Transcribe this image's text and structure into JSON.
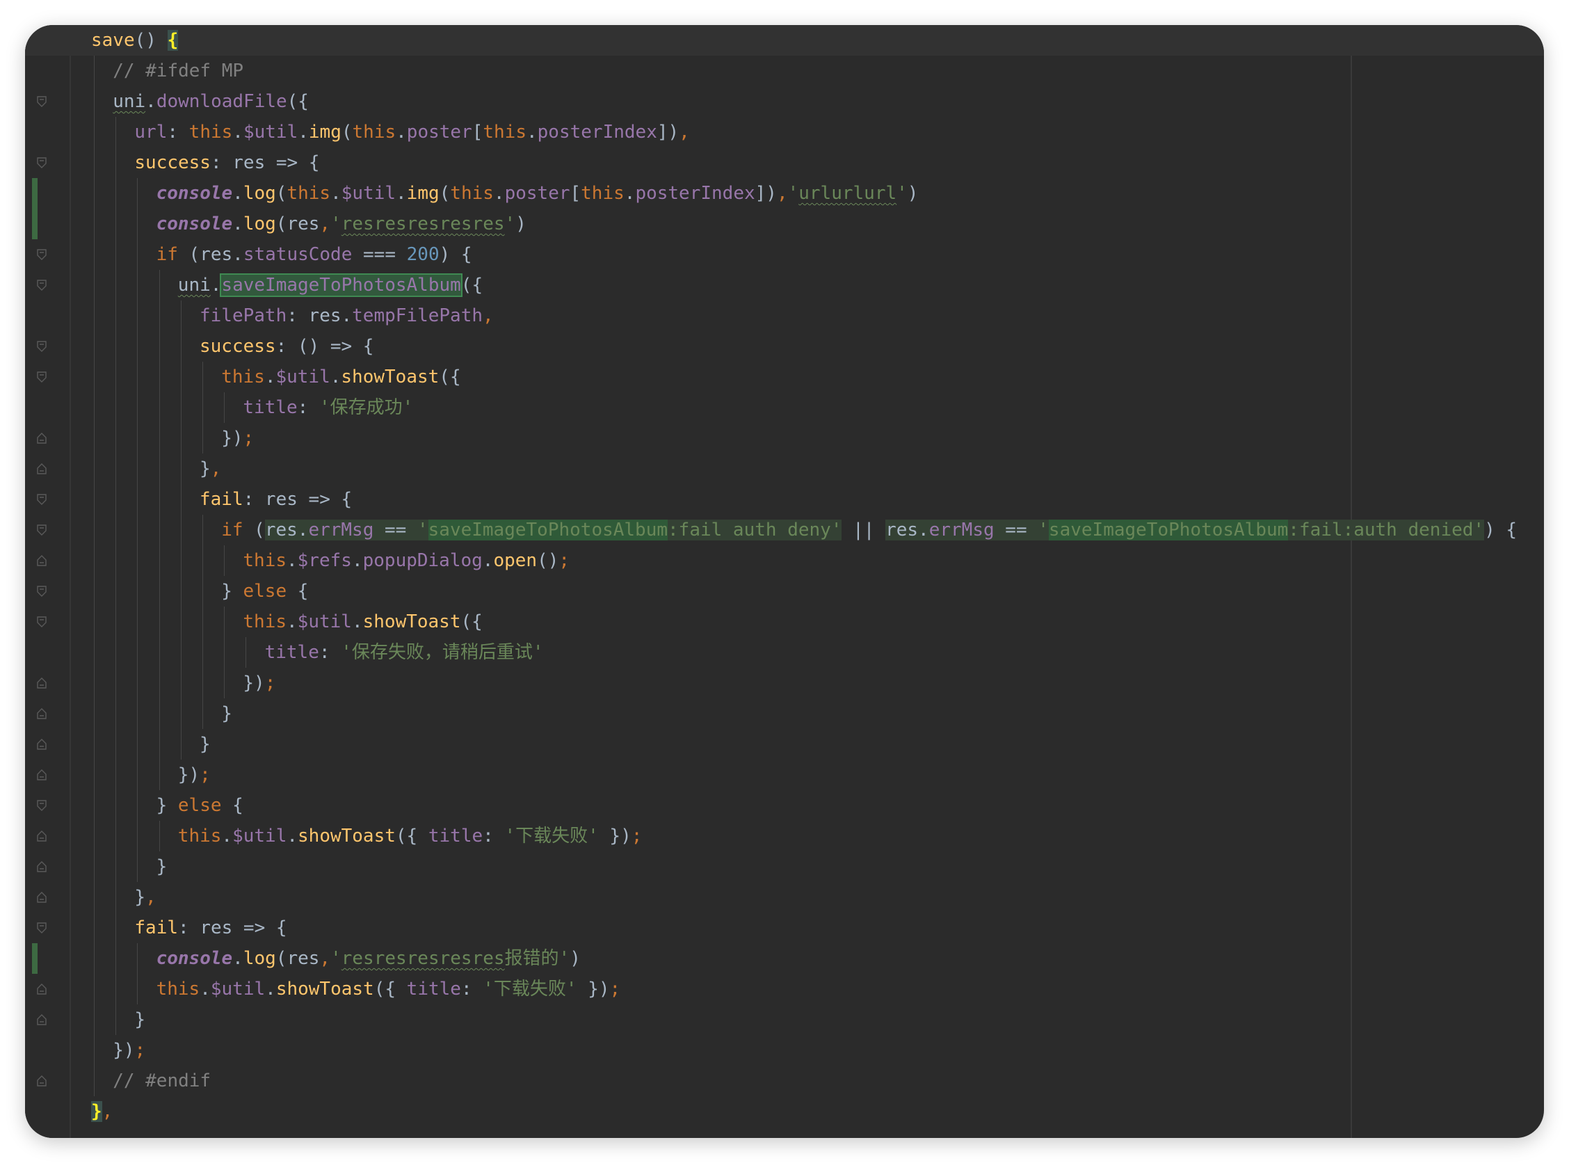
{
  "editor": {
    "language": "javascript",
    "colors": {
      "background": "#2b2b2b",
      "keyword": "#cc7832",
      "function": "#ffc66d",
      "property": "#9876aa",
      "string": "#6a8759",
      "number": "#6897bb",
      "comment": "#808080",
      "text": "#a9b7c6"
    },
    "lines": [
      {
        "indent": 1,
        "tokens": [
          {
            "t": "save",
            "c": "f"
          },
          {
            "t": "() "
          },
          {
            "t": "{",
            "c": "brace-y"
          }
        ]
      },
      {
        "indent": 2,
        "tokens": [
          {
            "t": "// #ifdef MP",
            "c": "c"
          }
        ]
      },
      {
        "indent": 2,
        "tokens": [
          {
            "t": "uni",
            "c": "sq"
          },
          {
            "t": "."
          },
          {
            "t": "downloadFile",
            "c": "p"
          },
          {
            "t": "({"
          }
        ]
      },
      {
        "indent": 3,
        "tokens": [
          {
            "t": "url",
            "c": "p"
          },
          {
            "t": ": "
          },
          {
            "t": "this",
            "c": "k"
          },
          {
            "t": "."
          },
          {
            "t": "$util",
            "c": "p"
          },
          {
            "t": "."
          },
          {
            "t": "img",
            "c": "f"
          },
          {
            "t": "("
          },
          {
            "t": "this",
            "c": "k"
          },
          {
            "t": "."
          },
          {
            "t": "poster",
            "c": "p"
          },
          {
            "t": "["
          },
          {
            "t": "this",
            "c": "k"
          },
          {
            "t": "."
          },
          {
            "t": "posterIndex",
            "c": "p"
          },
          {
            "t": "])"
          },
          {
            "t": ",",
            "c": "k"
          }
        ]
      },
      {
        "indent": 3,
        "tokens": [
          {
            "t": "success",
            "c": "f"
          },
          {
            "t": ": res => {"
          }
        ]
      },
      {
        "indent": 4,
        "tokens": [
          {
            "t": "console",
            "c": "ci"
          },
          {
            "t": "."
          },
          {
            "t": "log",
            "c": "f"
          },
          {
            "t": "("
          },
          {
            "t": "this",
            "c": "k"
          },
          {
            "t": "."
          },
          {
            "t": "$util",
            "c": "p"
          },
          {
            "t": "."
          },
          {
            "t": "img",
            "c": "f"
          },
          {
            "t": "("
          },
          {
            "t": "this",
            "c": "k"
          },
          {
            "t": "."
          },
          {
            "t": "poster",
            "c": "p"
          },
          {
            "t": "["
          },
          {
            "t": "this",
            "c": "k"
          },
          {
            "t": "."
          },
          {
            "t": "posterIndex",
            "c": "p"
          },
          {
            "t": "])"
          },
          {
            "t": ",",
            "c": "k"
          },
          {
            "t": "'",
            "c": "s"
          },
          {
            "t": "urlurlurl",
            "c": "s sq"
          },
          {
            "t": "'",
            "c": "s"
          },
          {
            "t": ")"
          }
        ]
      },
      {
        "indent": 4,
        "tokens": [
          {
            "t": "console",
            "c": "ci"
          },
          {
            "t": "."
          },
          {
            "t": "log",
            "c": "f"
          },
          {
            "t": "(res"
          },
          {
            "t": ",",
            "c": "k"
          },
          {
            "t": "'",
            "c": "s"
          },
          {
            "t": "resresresresres",
            "c": "s sq"
          },
          {
            "t": "'",
            "c": "s"
          },
          {
            "t": ")"
          }
        ]
      },
      {
        "indent": 4,
        "tokens": [
          {
            "t": "if",
            "c": "k"
          },
          {
            "t": " (res."
          },
          {
            "t": "statusCode",
            "c": "p"
          },
          {
            "t": " === "
          },
          {
            "t": "200",
            "c": "n"
          },
          {
            "t": ") {"
          }
        ]
      },
      {
        "indent": 5,
        "tokens": [
          {
            "t": "uni",
            "c": "sq"
          },
          {
            "t": "."
          },
          {
            "t": "saveImageToPhotosAlbum",
            "c": "p sel"
          },
          {
            "t": "({"
          }
        ]
      },
      {
        "indent": 6,
        "tokens": [
          {
            "t": "filePath",
            "c": "p"
          },
          {
            "t": ": res."
          },
          {
            "t": "tempFilePath",
            "c": "p"
          },
          {
            "t": ",",
            "c": "k"
          }
        ]
      },
      {
        "indent": 6,
        "tokens": [
          {
            "t": "success",
            "c": "f"
          },
          {
            "t": ": () => {"
          }
        ]
      },
      {
        "indent": 7,
        "tokens": [
          {
            "t": "this",
            "c": "k"
          },
          {
            "t": "."
          },
          {
            "t": "$util",
            "c": "p"
          },
          {
            "t": "."
          },
          {
            "t": "showToast",
            "c": "f"
          },
          {
            "t": "({"
          }
        ]
      },
      {
        "indent": 8,
        "tokens": [
          {
            "t": "title",
            "c": "p"
          },
          {
            "t": ": "
          },
          {
            "t": "'保存成功'",
            "c": "s"
          }
        ]
      },
      {
        "indent": 7,
        "tokens": [
          {
            "t": "})"
          },
          {
            "t": ";",
            "c": "k"
          }
        ]
      },
      {
        "indent": 6,
        "tokens": [
          {
            "t": "}"
          },
          {
            "t": ",",
            "c": "k"
          }
        ]
      },
      {
        "indent": 6,
        "tokens": [
          {
            "t": "fail",
            "c": "f"
          },
          {
            "t": ": res => {"
          }
        ]
      },
      {
        "indent": 7,
        "tokens": [
          {
            "t": "if",
            "c": "k"
          },
          {
            "t": " ("
          },
          {
            "t": "res.",
            "c": "hl"
          },
          {
            "t": "errMsg",
            "c": "p hl"
          },
          {
            "t": " == ",
            "c": "hl"
          },
          {
            "t": "'",
            "c": "s hl"
          },
          {
            "t": "saveImageToPhotosAlbum",
            "c": "s hl2"
          },
          {
            "t": ":fail auth deny'",
            "c": "s hl"
          },
          {
            "t": " || "
          },
          {
            "t": "res.",
            "c": "hl"
          },
          {
            "t": "errMsg",
            "c": "p hl"
          },
          {
            "t": " == ",
            "c": "hl"
          },
          {
            "t": "'",
            "c": "s hl"
          },
          {
            "t": "saveImageToPhotosAlbum",
            "c": "s hl2"
          },
          {
            "t": ":fail:auth denied'",
            "c": "s hl"
          },
          {
            "t": ") {"
          }
        ]
      },
      {
        "indent": 8,
        "tokens": [
          {
            "t": "this",
            "c": "k"
          },
          {
            "t": "."
          },
          {
            "t": "$refs",
            "c": "p"
          },
          {
            "t": "."
          },
          {
            "t": "popupDialog",
            "c": "p"
          },
          {
            "t": "."
          },
          {
            "t": "open",
            "c": "f"
          },
          {
            "t": "()"
          },
          {
            "t": ";",
            "c": "k"
          }
        ]
      },
      {
        "indent": 7,
        "tokens": [
          {
            "t": "} "
          },
          {
            "t": "else",
            "c": "k"
          },
          {
            "t": " {"
          }
        ]
      },
      {
        "indent": 8,
        "tokens": [
          {
            "t": "this",
            "c": "k"
          },
          {
            "t": "."
          },
          {
            "t": "$util",
            "c": "p"
          },
          {
            "t": "."
          },
          {
            "t": "showToast",
            "c": "f"
          },
          {
            "t": "({"
          }
        ]
      },
      {
        "indent": 9,
        "tokens": [
          {
            "t": "title",
            "c": "p"
          },
          {
            "t": ": "
          },
          {
            "t": "'保存失败，请稍后重试'",
            "c": "s"
          }
        ]
      },
      {
        "indent": 8,
        "tokens": [
          {
            "t": "})"
          },
          {
            "t": ";",
            "c": "k"
          }
        ]
      },
      {
        "indent": 7,
        "tokens": [
          {
            "t": "}"
          }
        ]
      },
      {
        "indent": 6,
        "tokens": [
          {
            "t": "}"
          }
        ]
      },
      {
        "indent": 5,
        "tokens": [
          {
            "t": "})"
          },
          {
            "t": ";",
            "c": "k"
          }
        ]
      },
      {
        "indent": 4,
        "tokens": [
          {
            "t": "} "
          },
          {
            "t": "else",
            "c": "k"
          },
          {
            "t": " {"
          }
        ]
      },
      {
        "indent": 5,
        "tokens": [
          {
            "t": "this",
            "c": "k"
          },
          {
            "t": "."
          },
          {
            "t": "$util",
            "c": "p"
          },
          {
            "t": "."
          },
          {
            "t": "showToast",
            "c": "f"
          },
          {
            "t": "({ "
          },
          {
            "t": "title",
            "c": "p"
          },
          {
            "t": ": "
          },
          {
            "t": "'下载失败'",
            "c": "s"
          },
          {
            "t": " })"
          },
          {
            "t": ";",
            "c": "k"
          }
        ]
      },
      {
        "indent": 4,
        "tokens": [
          {
            "t": "}"
          }
        ]
      },
      {
        "indent": 3,
        "tokens": [
          {
            "t": "}"
          },
          {
            "t": ",",
            "c": "k"
          }
        ]
      },
      {
        "indent": 3,
        "tokens": [
          {
            "t": "fail",
            "c": "f"
          },
          {
            "t": ": res => {"
          }
        ]
      },
      {
        "indent": 4,
        "tokens": [
          {
            "t": "console",
            "c": "ci"
          },
          {
            "t": "."
          },
          {
            "t": "log",
            "c": "f"
          },
          {
            "t": "(res"
          },
          {
            "t": ",",
            "c": "k"
          },
          {
            "t": "'",
            "c": "s"
          },
          {
            "t": "resresresresres",
            "c": "s sq"
          },
          {
            "t": "报错的'",
            "c": "s"
          },
          {
            "t": ")"
          }
        ]
      },
      {
        "indent": 4,
        "tokens": [
          {
            "t": "this",
            "c": "k"
          },
          {
            "t": "."
          },
          {
            "t": "$util",
            "c": "p"
          },
          {
            "t": "."
          },
          {
            "t": "showToast",
            "c": "f"
          },
          {
            "t": "({ "
          },
          {
            "t": "title",
            "c": "p"
          },
          {
            "t": ": "
          },
          {
            "t": "'下载失败'",
            "c": "s"
          },
          {
            "t": " })"
          },
          {
            "t": ";",
            "c": "k"
          }
        ]
      },
      {
        "indent": 3,
        "tokens": [
          {
            "t": "}"
          }
        ]
      },
      {
        "indent": 2,
        "tokens": [
          {
            "t": "})"
          },
          {
            "t": ";",
            "c": "k"
          }
        ]
      },
      {
        "indent": 2,
        "tokens": [
          {
            "t": "// #endif",
            "c": "c"
          }
        ]
      },
      {
        "indent": 1,
        "tokens": [
          {
            "t": "}",
            "c": "brace-y"
          },
          {
            "t": ",",
            "c": "k"
          }
        ]
      }
    ]
  }
}
